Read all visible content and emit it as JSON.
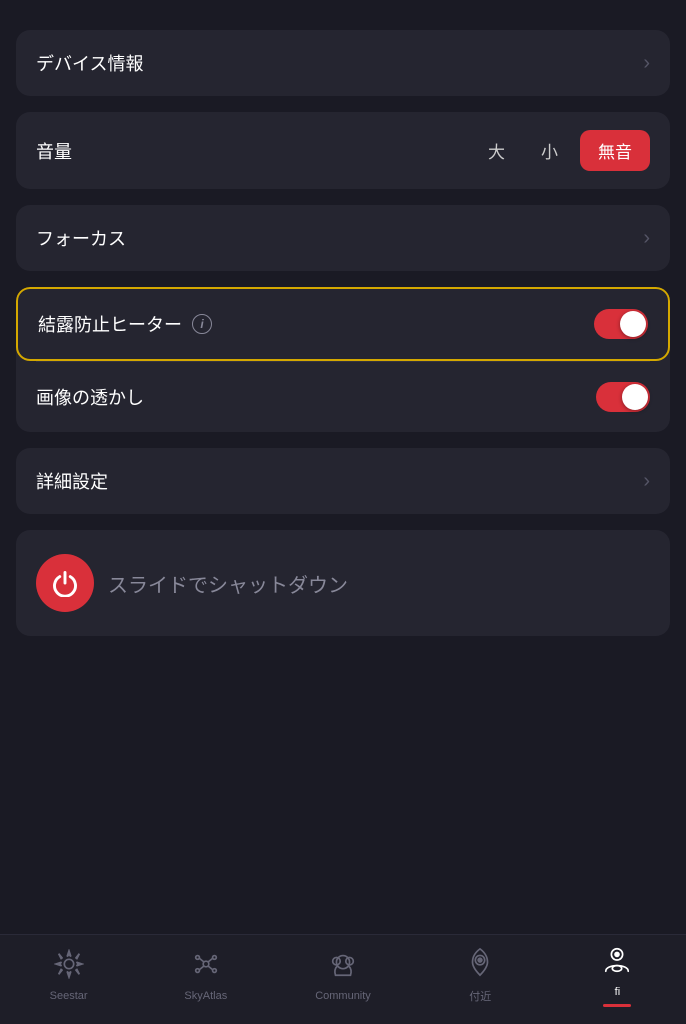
{
  "sections": {
    "device_info": {
      "label": "デバイス情報"
    },
    "volume": {
      "label": "音量",
      "options": [
        {
          "label": "大",
          "active": false
        },
        {
          "label": "小",
          "active": false
        },
        {
          "label": "無音",
          "active": true
        }
      ]
    },
    "focus": {
      "label": "フォーカス"
    },
    "anti_dew": {
      "label": "結露防止ヒーター",
      "toggle": true,
      "highlighted": true
    },
    "watermark": {
      "label": "画像の透かし",
      "toggle": true
    },
    "advanced": {
      "label": "詳細設定"
    },
    "shutdown": {
      "text": "スライドでシャットダウン"
    }
  },
  "nav": {
    "items": [
      {
        "id": "seestar",
        "label": "Seestar",
        "active": false
      },
      {
        "id": "skyatlas",
        "label": "SkyAtlas",
        "active": false
      },
      {
        "id": "community",
        "label": "Community",
        "active": false
      },
      {
        "id": "nearby",
        "label": "付近",
        "active": false
      },
      {
        "id": "profile",
        "label": "fi",
        "active": true
      }
    ]
  }
}
